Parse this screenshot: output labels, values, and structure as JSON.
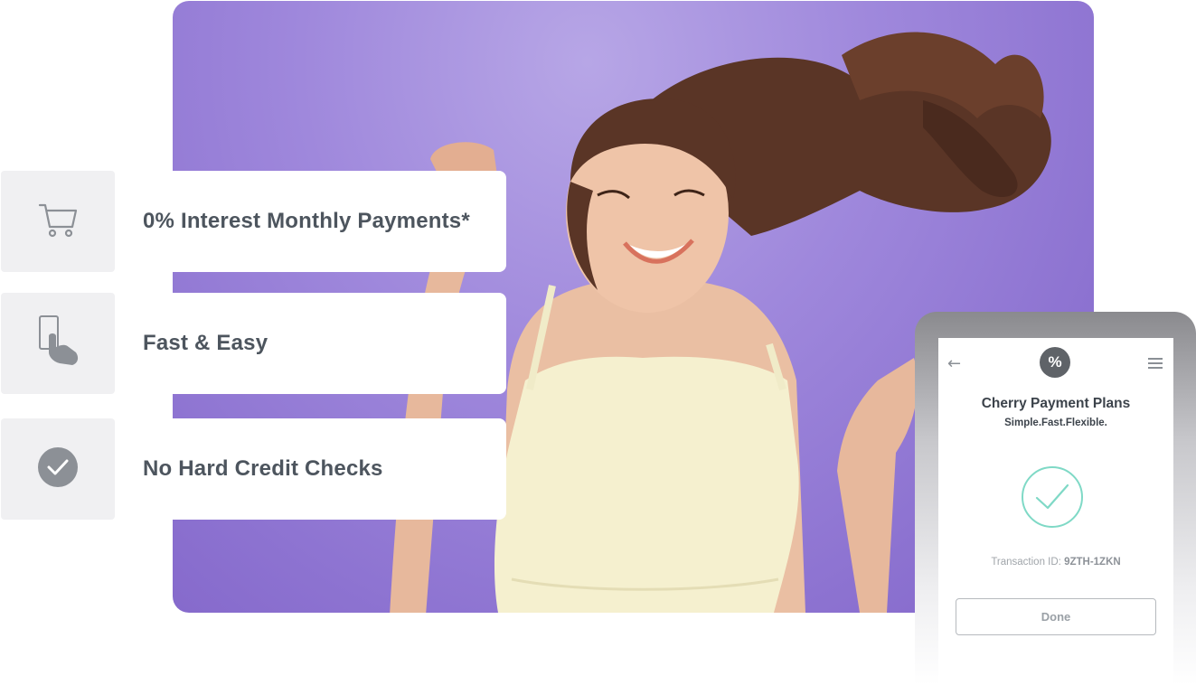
{
  "features": [
    {
      "label": "0% Interest Monthly Payments*",
      "icon": "shopping-cart-icon"
    },
    {
      "label": "Fast & Easy",
      "icon": "hand-tap-phone-icon"
    },
    {
      "label": "No Hard Credit Checks",
      "icon": "check-circle-icon"
    }
  ],
  "hero": {
    "subject": "smiling-woman-photo",
    "background_color": "#9a83d9"
  },
  "phone": {
    "logo_symbol": "%",
    "title": "Cherry Payment Plans",
    "subtitle": "Simple.Fast.Flexible.",
    "transaction_label": "Transaction ID:",
    "transaction_id": "9ZTH-1ZKN",
    "done_label": "Done",
    "back_icon": "back-arrow-icon",
    "menu_icon": "hamburger-menu-icon",
    "success_icon": "success-check-icon",
    "accent_color": "#7fd9c6"
  }
}
